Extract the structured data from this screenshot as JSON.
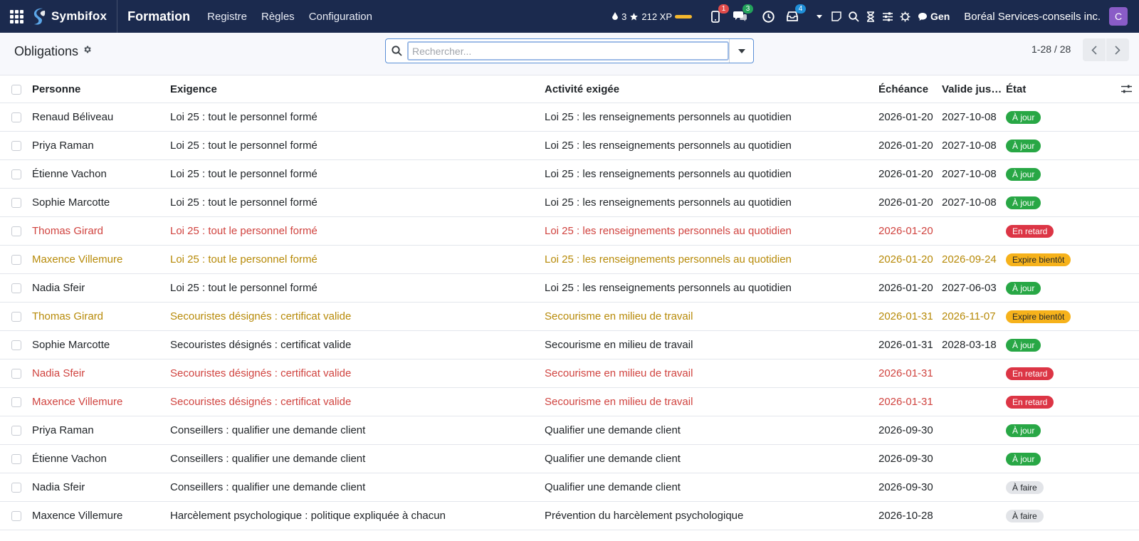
{
  "navbar": {
    "brand": "Symbifox",
    "app": "Formation",
    "menu": [
      "Registre",
      "Règles",
      "Configuration"
    ],
    "gamification": {
      "karma": "3",
      "xp": "212 XP"
    },
    "badges": {
      "phone": "1",
      "chat": "3",
      "activities": "4"
    },
    "gen_label": "Gen",
    "company": "Boréal Services-conseils inc.",
    "avatar_letter": "C"
  },
  "control": {
    "title": "Obligations",
    "search_placeholder": "Rechercher...",
    "pager": "1-28 / 28"
  },
  "table": {
    "headers": [
      "Personne",
      "Exigence",
      "Activité exigée",
      "Échéance",
      "Valide jus…",
      "État"
    ],
    "rows": [
      [
        "Renaud Béliveau",
        "Loi 25 : tout le personnel formé",
        "Loi 25 : les renseignements personnels au quotidien",
        "2026-01-20",
        "2027-10-08",
        "À jour",
        "ok"
      ],
      [
        "Priya Raman",
        "Loi 25 : tout le personnel formé",
        "Loi 25 : les renseignements personnels au quotidien",
        "2026-01-20",
        "2027-10-08",
        "À jour",
        "ok"
      ],
      [
        "Étienne Vachon",
        "Loi 25 : tout le personnel formé",
        "Loi 25 : les renseignements personnels au quotidien",
        "2026-01-20",
        "2027-10-08",
        "À jour",
        "ok"
      ],
      [
        "Sophie Marcotte",
        "Loi 25 : tout le personnel formé",
        "Loi 25 : les renseignements personnels au quotidien",
        "2026-01-20",
        "2027-10-08",
        "À jour",
        "ok"
      ],
      [
        "Thomas Girard",
        "Loi 25 : tout le personnel formé",
        "Loi 25 : les renseignements personnels au quotidien",
        "2026-01-20",
        "",
        "En retard",
        "late"
      ],
      [
        "Maxence Villemure",
        "Loi 25 : tout le personnel formé",
        "Loi 25 : les renseignements personnels au quotidien",
        "2026-01-20",
        "2026-09-24",
        "Expire bientôt",
        "soon"
      ],
      [
        "Nadia Sfeir",
        "Loi 25 : tout le personnel formé",
        "Loi 25 : les renseignements personnels au quotidien",
        "2026-01-20",
        "2027-06-03",
        "À jour",
        "ok"
      ],
      [
        "Thomas Girard",
        "Secouristes désignés : certificat valide",
        "Secourisme en milieu de travail",
        "2026-01-31",
        "2026-11-07",
        "Expire bientôt",
        "soon"
      ],
      [
        "Sophie Marcotte",
        "Secouristes désignés : certificat valide",
        "Secourisme en milieu de travail",
        "2026-01-31",
        "2028-03-18",
        "À jour",
        "ok"
      ],
      [
        "Nadia Sfeir",
        "Secouristes désignés : certificat valide",
        "Secourisme en milieu de travail",
        "2026-01-31",
        "",
        "En retard",
        "late"
      ],
      [
        "Maxence Villemure",
        "Secouristes désignés : certificat valide",
        "Secourisme en milieu de travail",
        "2026-01-31",
        "",
        "En retard",
        "late"
      ],
      [
        "Priya Raman",
        "Conseillers : qualifier une demande client",
        "Qualifier une demande client",
        "2026-09-30",
        "",
        "À jour",
        "ok"
      ],
      [
        "Étienne Vachon",
        "Conseillers : qualifier une demande client",
        "Qualifier une demande client",
        "2026-09-30",
        "",
        "À jour",
        "ok"
      ],
      [
        "Nadia Sfeir",
        "Conseillers : qualifier une demande client",
        "Qualifier une demande client",
        "2026-09-30",
        "",
        "À faire",
        "todo"
      ],
      [
        "Maxence Villemure",
        "Harcèlement psychologique : politique expliquée à chacun",
        "Prévention du harcèlement psychologique",
        "2026-10-28",
        "",
        "À faire",
        "todo"
      ]
    ]
  },
  "colors": {
    "navbar": "#1b2a4e",
    "late": "#d0433f",
    "soon": "#b78a08",
    "ok_pill": "#28a745",
    "late_pill": "#dc3545",
    "soon_pill": "#f6b21b",
    "todo_pill": "#e2e4e8"
  }
}
